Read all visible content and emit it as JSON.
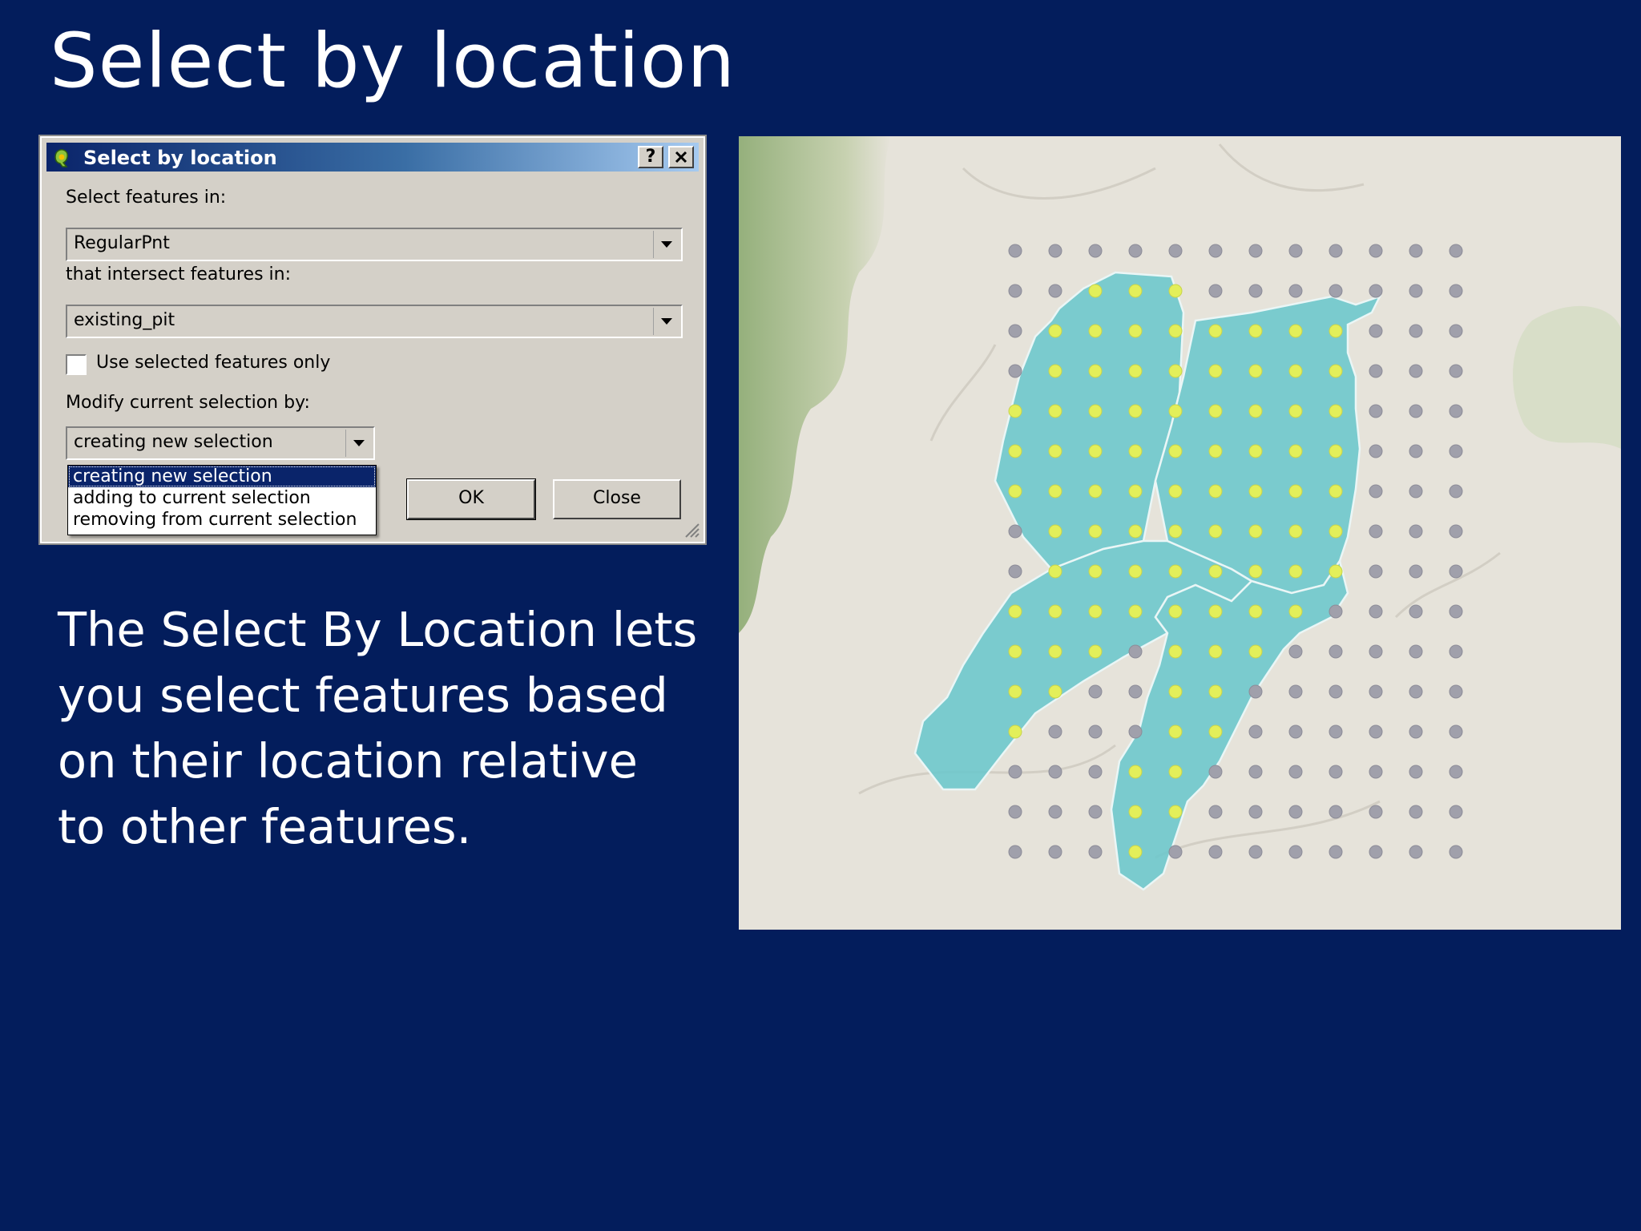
{
  "slide": {
    "title": "Select by location",
    "body": "The Select By Location lets you select features based on their location relative to other features."
  },
  "dialog": {
    "title": "Select by location",
    "help_label": "?",
    "close_icon_label": "×",
    "select_features_label": "Select features in:",
    "select_features_value": "RegularPnt",
    "intersect_label": "that intersect features in:",
    "intersect_value": "existing_pit",
    "use_selected_label": "Use selected features only",
    "use_selected_checked": false,
    "modify_label": "Modify current selection by:",
    "modify_value": "creating new selection",
    "modify_options": [
      "creating new selection",
      "adding to current selection",
      "removing from current selection"
    ],
    "ok_label": "OK",
    "close_label": "Close"
  },
  "map": {
    "point_layer": "RegularPnt",
    "polygon_layer": "existing_pit",
    "colors": {
      "polygon_fill": "#6ec8cc",
      "polygon_stroke": "#eaf6f6",
      "point_unselected": "#a0a0ab",
      "point_selected": "#e3ef5a",
      "background": "#e6e3da"
    }
  }
}
